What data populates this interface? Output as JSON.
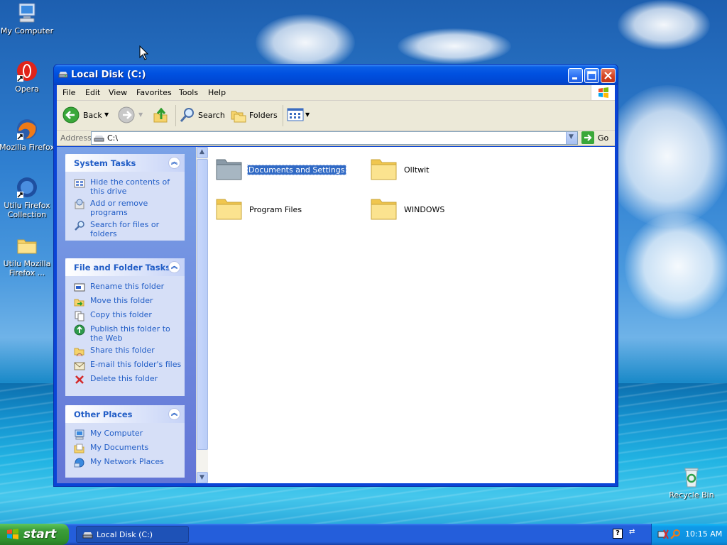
{
  "desktop": {
    "icons": [
      {
        "label": "My Computer"
      },
      {
        "label": "Opera"
      },
      {
        "label": "Mozilla Firefox"
      },
      {
        "label": "Utilu Firefox Collection"
      },
      {
        "label": "Utilu Mozilla Firefox ..."
      },
      {
        "label": "Recycle Bin"
      }
    ]
  },
  "window": {
    "title": "Local Disk (C:)",
    "menu": [
      "File",
      "Edit",
      "View",
      "Favorites",
      "Tools",
      "Help"
    ],
    "toolbar": {
      "back_label": "Back",
      "search_label": "Search",
      "folders_label": "Folders"
    },
    "address": {
      "label": "Address",
      "value": "C:\\",
      "go_label": "Go"
    },
    "panels": {
      "system_tasks": {
        "title": "System Tasks",
        "items": [
          "Hide the contents of this drive",
          "Add or remove programs",
          "Search for files or folders"
        ]
      },
      "file_folder_tasks": {
        "title": "File and Folder Tasks",
        "items": [
          "Rename this folder",
          "Move this folder",
          "Copy this folder",
          "Publish this folder to the Web",
          "Share this folder",
          "E-mail this folder's files",
          "Delete this folder"
        ]
      },
      "other_places": {
        "title": "Other Places",
        "items": [
          "My Computer",
          "My Documents",
          "My Network Places"
        ]
      }
    },
    "files": [
      {
        "name": "Documents and Settings",
        "selected": true
      },
      {
        "name": "Olltwit",
        "selected": false
      },
      {
        "name": "Program Files",
        "selected": false
      },
      {
        "name": "WINDOWS",
        "selected": false
      }
    ]
  },
  "taskbar": {
    "start_label": "start",
    "task_label": "Local Disk (C:)",
    "clock": "10:15 AM"
  },
  "colors": {
    "title_blue": "#0050e0",
    "task_link": "#215dc6",
    "selection": "#316ac5",
    "start_green": "#3c9e3a"
  }
}
